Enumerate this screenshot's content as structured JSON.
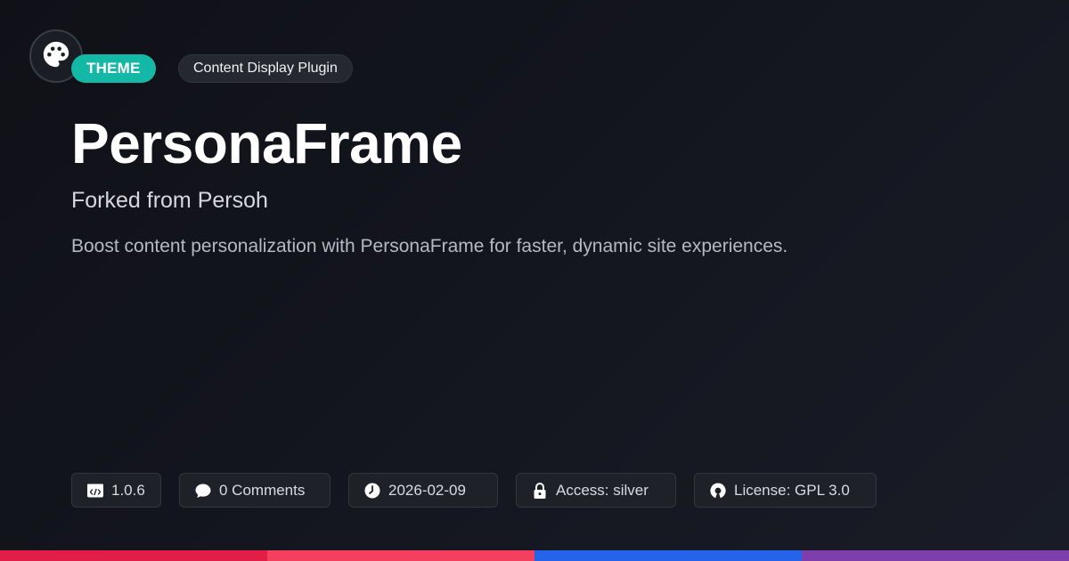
{
  "header": {
    "logo_icon": "palette-icon",
    "type_badge": "THEME",
    "category_badge": "Content Display Plugin"
  },
  "main": {
    "title": "PersonaFrame",
    "subtitle": "Forked from Persoh",
    "description": "Boost content personalization with PersonaFrame for faster, dynamic site experiences."
  },
  "meta": {
    "version": {
      "icon": "code-icon",
      "text": "1.0.6"
    },
    "comments": {
      "icon": "comment-icon",
      "text": "0 Comments"
    },
    "date": {
      "icon": "clock-icon",
      "text": "2026-02-09"
    },
    "access": {
      "icon": "lock-icon",
      "text": "Access: silver"
    },
    "license": {
      "icon": "open-source-icon",
      "text": "License: GPL 3.0"
    }
  },
  "colors": {
    "theme_badge": "#14b8a6",
    "bar_1": "#e11d48",
    "bar_2": "#f43f5e",
    "bar_3": "#2563eb",
    "bar_4": "#7e3fad"
  }
}
